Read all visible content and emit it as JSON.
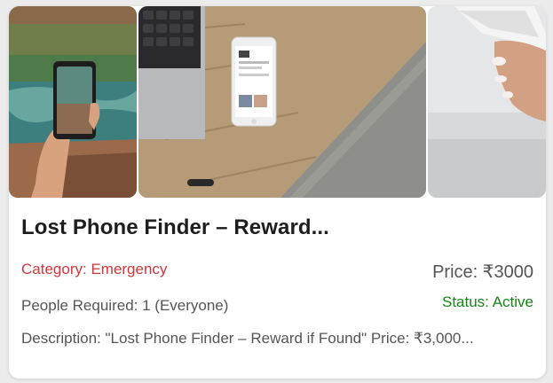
{
  "listing": {
    "title": "Lost Phone Finder – Reward...",
    "category_label": "Category:",
    "category_value": "Emergency",
    "price_label": "Price:",
    "price_value": "₹3000",
    "people_label": "People Required:",
    "people_value": "1 (Everyone)",
    "status_label": "Status:",
    "status_value": "Active",
    "description_label": "Description:",
    "description_value": "\"Lost Phone Finder – Reward if Found\" Price: ₹3,000..."
  },
  "images": [
    {
      "name": "photo-hand-phone-waterfall"
    },
    {
      "name": "photo-phone-on-desk-laptop"
    },
    {
      "name": "photo-hand-holding-phone"
    }
  ],
  "colors": {
    "category": "#d2363a",
    "status": "#188318",
    "title": "#1e1e1e",
    "body": "#555555"
  }
}
